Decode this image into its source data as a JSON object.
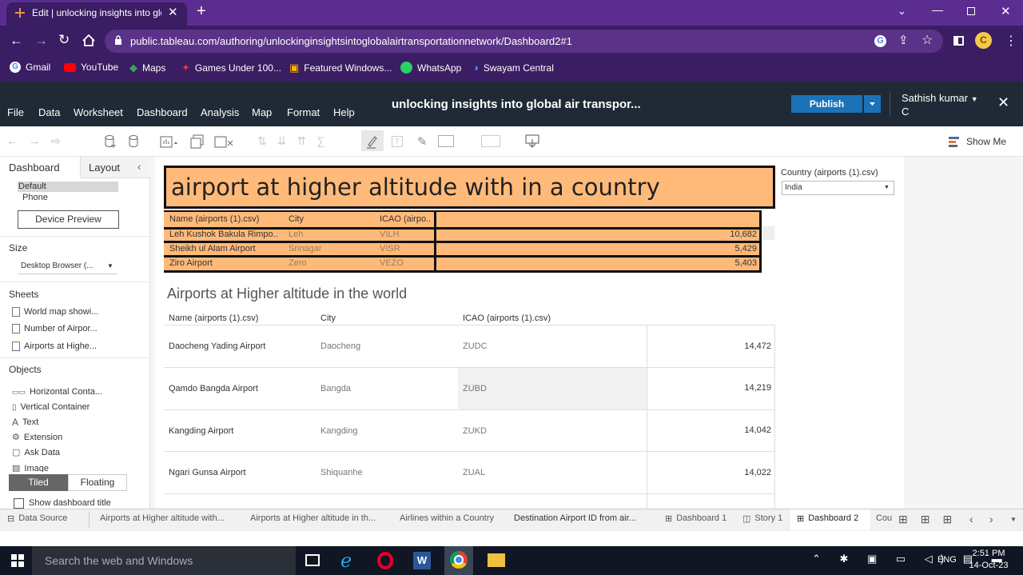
{
  "browser": {
    "tab_title": "Edit | unlocking insights into glo",
    "url": "public.tableau.com/authoring/unlockinginsightsintoglobalairtransportationnetwork/Dashboard2#1",
    "bookmarks": [
      "Gmail",
      "YouTube",
      "Maps",
      "Games Under 100...",
      "Featured Windows...",
      "WhatsApp",
      "Swayam Central"
    ]
  },
  "tableau": {
    "menu": [
      "File",
      "Data",
      "Worksheet",
      "Dashboard",
      "Analysis",
      "Map",
      "Format",
      "Help"
    ],
    "workbook_title": "unlocking insights into global air transpor...",
    "publish_label": "Publish",
    "user_name": "Sathish kumar",
    "user_name_line2": "C",
    "show_me": "Show Me"
  },
  "left_pane": {
    "tab_dashboard": "Dashboard",
    "tab_layout": "Layout",
    "device_default": "Default",
    "device_phone": "Phone",
    "device_preview": "Device Preview",
    "size_label": "Size",
    "size_value": "Desktop Browser (...",
    "sheets_label": "Sheets",
    "sheets": [
      "World map showi...",
      "Number of Airpor...",
      "Airports at Highe..."
    ],
    "objects_label": "Objects",
    "objects": [
      "Horizontal Conta...",
      "Vertical Container",
      "Text",
      "Extension",
      "Ask Data",
      "Image"
    ],
    "tiled": "Tiled",
    "floating": "Floating",
    "show_title": "Show dashboard title"
  },
  "dashboard": {
    "title": "airport at higher altitude with in a country",
    "country_table": {
      "headers": [
        "Name (airports (1).csv)",
        "City",
        "ICAO (airpo.."
      ],
      "rows": [
        [
          "Leh Kushok Bakula Rimpo..",
          "Leh",
          "VILH",
          "10,682"
        ],
        [
          "Sheikh ul Alam Airport",
          "Srinagar",
          "VISR",
          "5,429"
        ],
        [
          "Ziro Airport",
          "Zero",
          "VEZO",
          "5,403"
        ]
      ]
    },
    "world_title": "Airports at Higher altitude in the world",
    "world_table": {
      "headers": [
        "Name (airports (1).csv)",
        "City",
        "ICAO (airports (1).csv)"
      ],
      "rows": [
        [
          "Daocheng Yading Airport",
          "Daocheng",
          "ZUDC",
          "14,472"
        ],
        [
          "Qamdo Bangda Airport",
          "Bangda",
          "ZUBD",
          "14,219"
        ],
        [
          "Kangding Airport",
          "Kangding",
          "ZUKD",
          "14,042"
        ],
        [
          "Ngari Gunsa Airport",
          "Shiquanhe",
          "ZUAL",
          "14,022"
        ]
      ]
    },
    "filter_label": "Country (airports (1).csv)",
    "filter_value": "India"
  },
  "sheet_tabs": {
    "data_source": "Data Source",
    "tabs": [
      "Airports at Higher altitude with...",
      "Airports at Higher altitude in th...",
      "Airlines within a Country",
      "Destination Airport ID from air...",
      "Dashboard 1",
      "Story 1",
      "Dashboard 2",
      "Cou"
    ]
  },
  "taskbar": {
    "search_placeholder": "Search the web and Windows",
    "lang": "ENG",
    "time": "2:51 PM",
    "date": "14-Oct-23"
  },
  "colors": {
    "browser_tab_strip": "#5c2d91",
    "browser_toolbar": "#3a1d63",
    "tableau_header": "#1f2a36",
    "highlight_orange": "#ffba7a",
    "publish_blue": "#1a73b8"
  }
}
